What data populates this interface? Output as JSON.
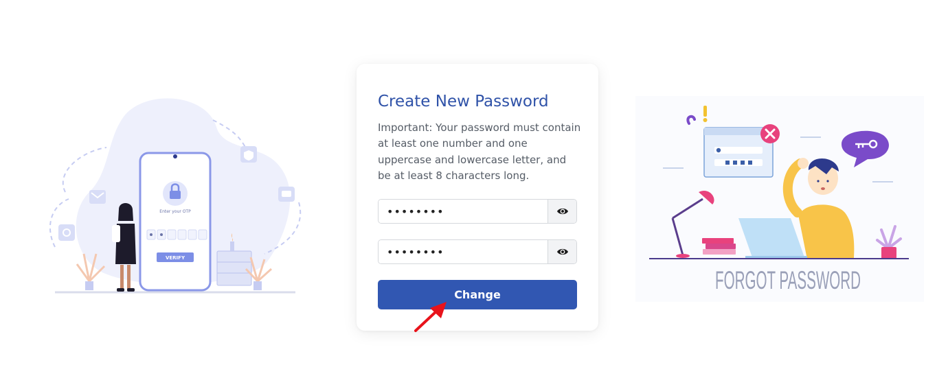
{
  "form": {
    "title": "Create New Password",
    "description": "Important: Your password must contain at least one number and one uppercase and lowercase letter, and be at least 8 characters long.",
    "new_password_value": "••••••••",
    "confirm_password_value": "••••••••",
    "submit_label": "Change"
  },
  "left_illustration": {
    "phone_text": "Enter your OTP",
    "verify_label": "VERIFY"
  },
  "right_illustration": {
    "caption": "FORGOT PASSWORD"
  },
  "colors": {
    "primary": "#3157b2",
    "title": "#2f52a8",
    "annotation_arrow": "#e8131b"
  }
}
